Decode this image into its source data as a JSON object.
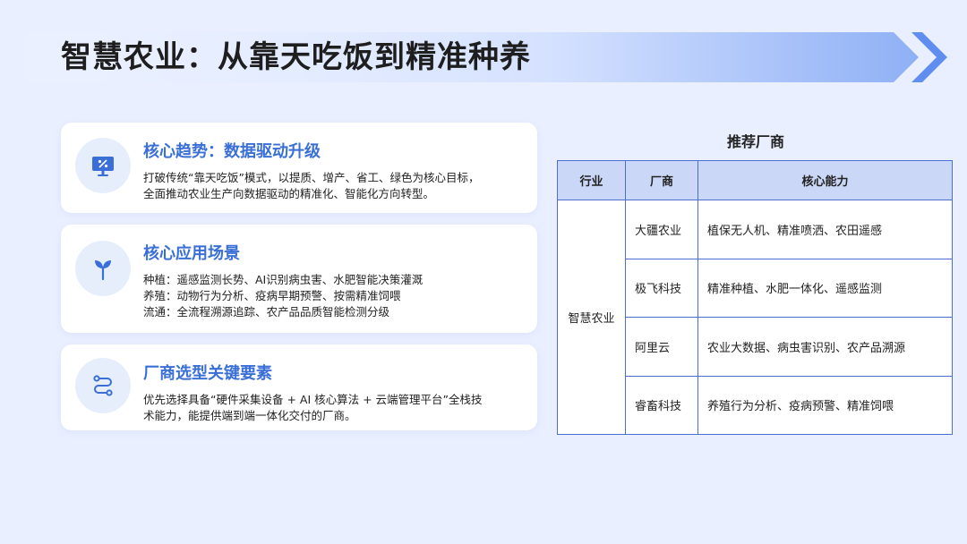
{
  "page": {
    "title": "智慧农业：从靠天吃饭到精准种养"
  },
  "cards": [
    {
      "icon": "presentation-chart-icon",
      "title": "核心趋势：数据驱动升级",
      "lines": [
        "打破传统“靠天吃饭”模式，以提质、增产、省工、绿色为核心目标，",
        "全面推动农业生产向数据驱动的精准化、智能化方向转型。"
      ]
    },
    {
      "icon": "sprout-icon",
      "title": "核心应用场景",
      "lines": [
        "种植：遥感监测长势、AI识别病虫害、水肥智能决策灌溉",
        "养殖：动物行为分析、疫病早期预警、按需精准饲喂",
        "流通：全流程溯源追踪、农产品品质智能检测分级"
      ]
    },
    {
      "icon": "route-icon",
      "title": "厂商选型关键要素",
      "lines": [
        "优先选择具备“硬件采集设备 + AI 核心算法 + 云端管理平台”全栈技",
        "术能力，能提供端到端一体化交付的厂商。"
      ]
    }
  ],
  "vendor_table": {
    "heading": "推荐厂商",
    "headers": [
      "行业",
      "厂商",
      "核心能力"
    ],
    "industry": "智慧农业",
    "rows": [
      {
        "vendor": "大疆农业",
        "capability": "植保无人机、精准喷洒、农田遥感"
      },
      {
        "vendor": "极飞科技",
        "capability": "精准种植、水肥一体化、遥感监测"
      },
      {
        "vendor": "阿里云",
        "capability": "农业大数据、病虫害识别、农产品溯源"
      },
      {
        "vendor": "睿畜科技",
        "capability": "养殖行为分析、疫病预警、精准饲喂"
      }
    ]
  },
  "colors": {
    "accent": "#3a6fd8",
    "background": "#e9efff",
    "table_border": "#4a6fce",
    "table_header": "#cbd7f6"
  }
}
